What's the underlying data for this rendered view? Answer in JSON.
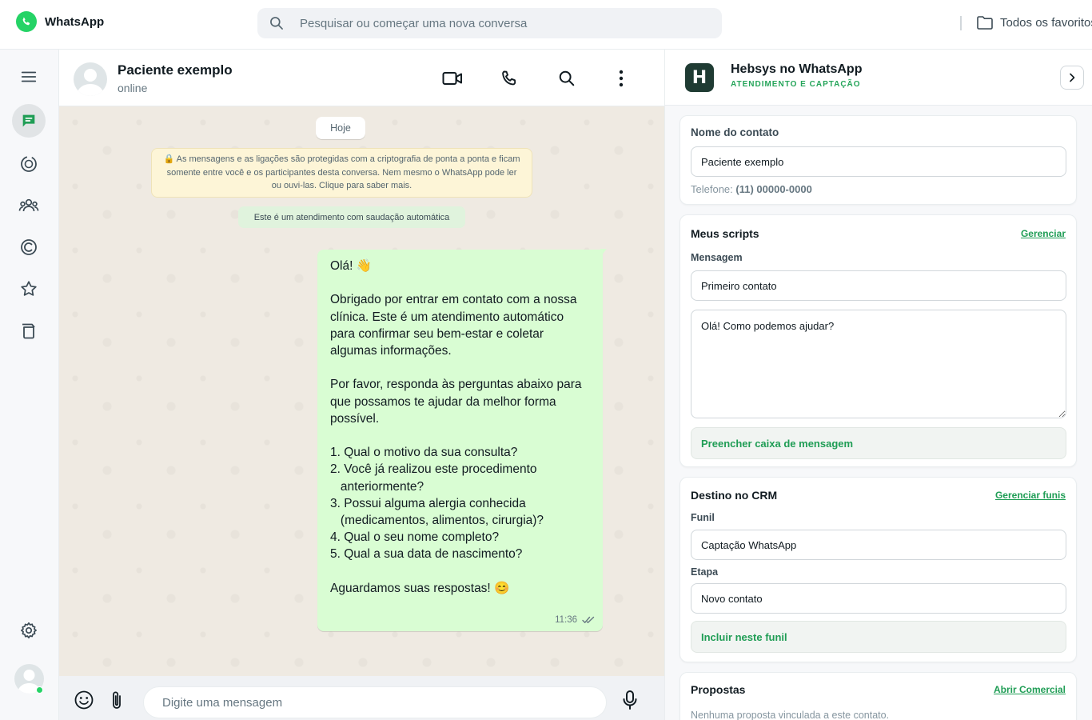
{
  "topbar": {
    "app_name": "WhatsApp",
    "search_placeholder": "Pesquisar ou começar uma nova conversa",
    "favorites_label": "Todos os favoritos"
  },
  "rail": {
    "items": [
      "menu",
      "chats",
      "status",
      "communities",
      "channels",
      "starred",
      "archived"
    ],
    "bottom": [
      "settings",
      "profile"
    ]
  },
  "chat": {
    "contact_name": "Paciente exemplo",
    "contact_status": "online",
    "date_chip": "Hoje",
    "encryption_notice": "🔒 As mensagens e as ligações são protegidas com a criptografia de ponta a ponta e ficam somente entre você e os participantes desta conversa. Nem mesmo o WhatsApp pode ler ou ouvi-las. Clique para saber mais.",
    "auto_notice": "Este é um atendimento com saudação automática",
    "message": {
      "text": "Olá! 👋\n\nObrigado por entrar em contato com a nossa clínica. Este é um atendimento automático para confirmar seu bem-estar e coletar algumas informações.\n\nPor favor, responda às perguntas abaixo para que possamos te ajudar da melhor forma possível.\n\n1. Qual o motivo da sua consulta?\n2. Você já realizou este procedimento\n   anteriormente?\n3. Possui alguma alergia conhecida\n   (medicamentos, alimentos, cirurgia)?\n4. Qual o seu nome completo?\n5. Qual a sua data de nascimento?\n\nAguardamos suas respostas! 😊",
      "time": "11:36"
    },
    "composer_placeholder": "Digite uma mensagem"
  },
  "panel": {
    "title": "Hebsys no WhatsApp",
    "subtitle": "ATENDIMENTO E CAPTAÇÃO",
    "logo_letter": "H",
    "contact": {
      "label": "Nome do contato",
      "name_value": "Paciente exemplo",
      "phone_label": "Telefone:",
      "phone_value": "(11) 00000-0000"
    },
    "scripts": {
      "title": "Meus scripts",
      "manage_link": "Gerenciar",
      "message_label": "Mensagem",
      "selected_script": "Primeiro contato",
      "script_body": "Olá! Como podemos ajudar?",
      "fill_button": "Preencher caixa de mensagem"
    },
    "crm": {
      "title": "Destino no CRM",
      "manage_link": "Gerenciar funis",
      "funnel_label": "Funil",
      "funnel_value": "Captação WhatsApp",
      "stage_label": "Etapa",
      "stage_value": "Novo contato",
      "include_button": "Incluir neste funil"
    },
    "proposals": {
      "title": "Propostas",
      "open_link": "Abrir Comercial",
      "empty_text": "Nenhuma proposta vinculada a este contato."
    }
  },
  "colors": {
    "accent": "#25d366",
    "accent_dark": "#1f9d55",
    "bubble_out": "#d9fdd3",
    "chat_bg": "#efeae2"
  }
}
